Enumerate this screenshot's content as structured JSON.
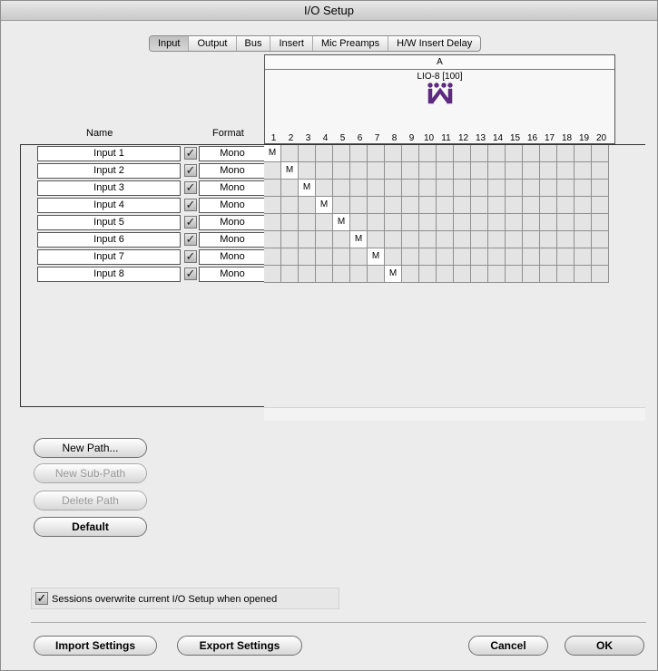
{
  "window": {
    "title": "I/O Setup"
  },
  "tabs": [
    {
      "label": "Input",
      "active": true
    },
    {
      "label": "Output",
      "active": false
    },
    {
      "label": "Bus",
      "active": false
    },
    {
      "label": "Insert",
      "active": false
    },
    {
      "label": "Mic Preamps",
      "active": false
    },
    {
      "label": "H/W Insert Delay",
      "active": false
    }
  ],
  "matrix": {
    "group": "A",
    "device": "LIO-8 [100]",
    "device_icon": "lio8-device-icon",
    "columns": [
      "1",
      "2",
      "3",
      "4",
      "5",
      "6",
      "7",
      "8",
      "9",
      "10",
      "11",
      "12",
      "13",
      "14",
      "15",
      "16",
      "17",
      "18",
      "19",
      "20"
    ]
  },
  "headers": {
    "name": "Name",
    "format": "Format"
  },
  "paths": [
    {
      "name": "Input 1",
      "enabled": true,
      "format": "Mono",
      "assigned": 1,
      "mark": "M"
    },
    {
      "name": "Input 2",
      "enabled": true,
      "format": "Mono",
      "assigned": 2,
      "mark": "M"
    },
    {
      "name": "Input 3",
      "enabled": true,
      "format": "Mono",
      "assigned": 3,
      "mark": "M"
    },
    {
      "name": "Input 4",
      "enabled": true,
      "format": "Mono",
      "assigned": 4,
      "mark": "M"
    },
    {
      "name": "Input 5",
      "enabled": true,
      "format": "Mono",
      "assigned": 5,
      "mark": "M"
    },
    {
      "name": "Input 6",
      "enabled": true,
      "format": "Mono",
      "assigned": 6,
      "mark": "M"
    },
    {
      "name": "Input 7",
      "enabled": true,
      "format": "Mono",
      "assigned": 7,
      "mark": "M"
    },
    {
      "name": "Input 8",
      "enabled": true,
      "format": "Mono",
      "assigned": 8,
      "mark": "M"
    }
  ],
  "buttons": {
    "new_path": "New Path...",
    "new_sub_path": "New Sub-Path",
    "delete_path": "Delete Path",
    "default": "Default",
    "import": "Import Settings",
    "export": "Export Settings",
    "cancel": "Cancel",
    "ok": "OK"
  },
  "options": {
    "sessions_overwrite_label": "Sessions overwrite current I/O Setup when opened",
    "sessions_overwrite_checked": true
  },
  "colors": {
    "device_icon": "#5c2a7e",
    "window_bg": "#ececec"
  }
}
